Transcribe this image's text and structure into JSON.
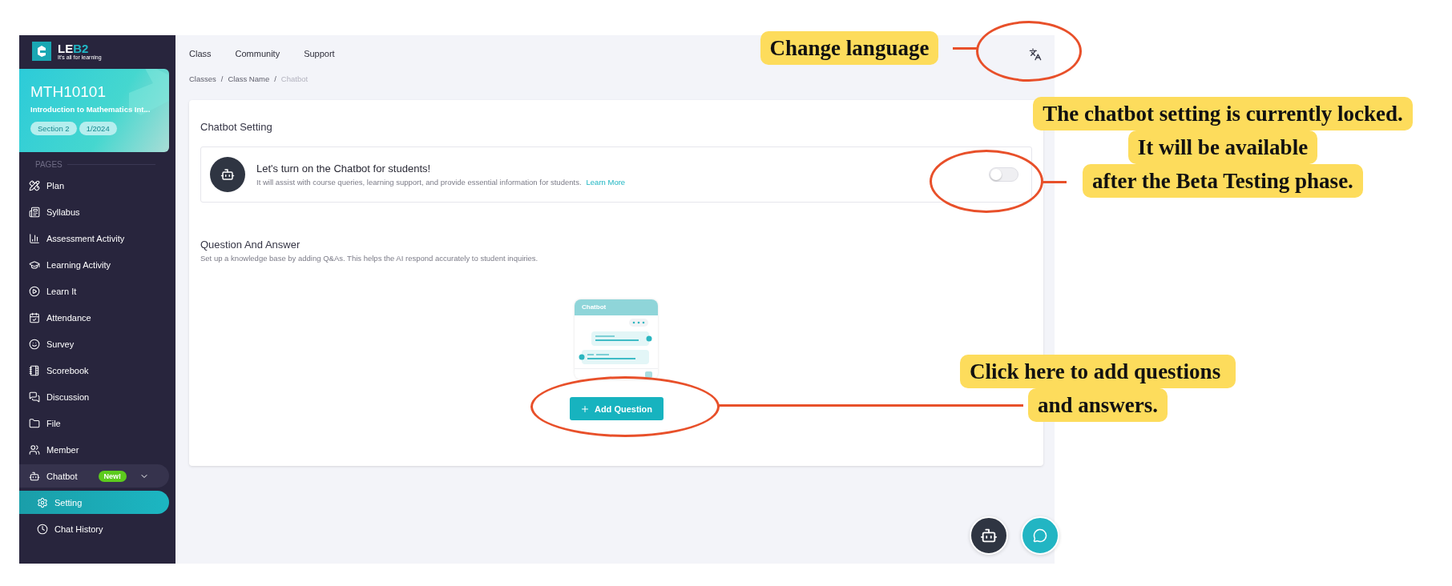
{
  "sidebar": {
    "logo": {
      "name": "LE**B2**",
      "tagline": "It's all for learning"
    },
    "course": {
      "code": "MTH10101",
      "title": "Introduction to Mathematics Int...",
      "tags": [
        "Section 2",
        "1/2024"
      ]
    },
    "section_label": "PAGES",
    "items": [
      {
        "label": "Plan",
        "selected": false
      },
      {
        "label": "Syllabus",
        "selected": false
      },
      {
        "label": "Assessment Activity",
        "selected": false
      },
      {
        "label": "Learning Activity",
        "selected": false
      },
      {
        "label": "Learn It",
        "selected": false
      },
      {
        "label": "Attendance",
        "selected": false
      },
      {
        "label": "Survey",
        "selected": false
      },
      {
        "label": "Scorebook",
        "selected": false
      },
      {
        "label": "Discussion",
        "selected": false
      },
      {
        "label": "File",
        "selected": false
      },
      {
        "label": "Member",
        "selected": false
      },
      {
        "label": "Chatbot",
        "selected": false,
        "expanded": true,
        "badge": "New!",
        "children": [
          {
            "label": "Setting",
            "selected": true
          },
          {
            "label": "Chat History",
            "selected": false
          }
        ]
      }
    ]
  },
  "top_nav": [
    "Class",
    "Community",
    "Support"
  ],
  "breadcrumb": {
    "separator": "/",
    "items": [
      "Classes",
      "Class Name",
      "Chatbot"
    ]
  },
  "chatbot_setting": {
    "title": "Chatbot Setting",
    "heading": "Let's turn on the Chatbot for students!",
    "description": "It will assist with course queries, learning support, and provide essential information for students.",
    "link": "Learn More",
    "on": false
  },
  "qa": {
    "title": "Question And Answer",
    "description": "Set up a knowledge base by adding Q&As. This helps the AI respond accurately to student inquiries.",
    "illustration_title": "Chatbot",
    "button": "Add Question"
  },
  "annotations": [
    {
      "lines": [
        "Change language"
      ]
    },
    {
      "lines": [
        "The chatbot setting is currently locked.",
        "It will be available",
        "after the Beta Testing phase."
      ]
    },
    {
      "lines": [
        "Click here to add questions ",
        "and answers."
      ]
    }
  ]
}
